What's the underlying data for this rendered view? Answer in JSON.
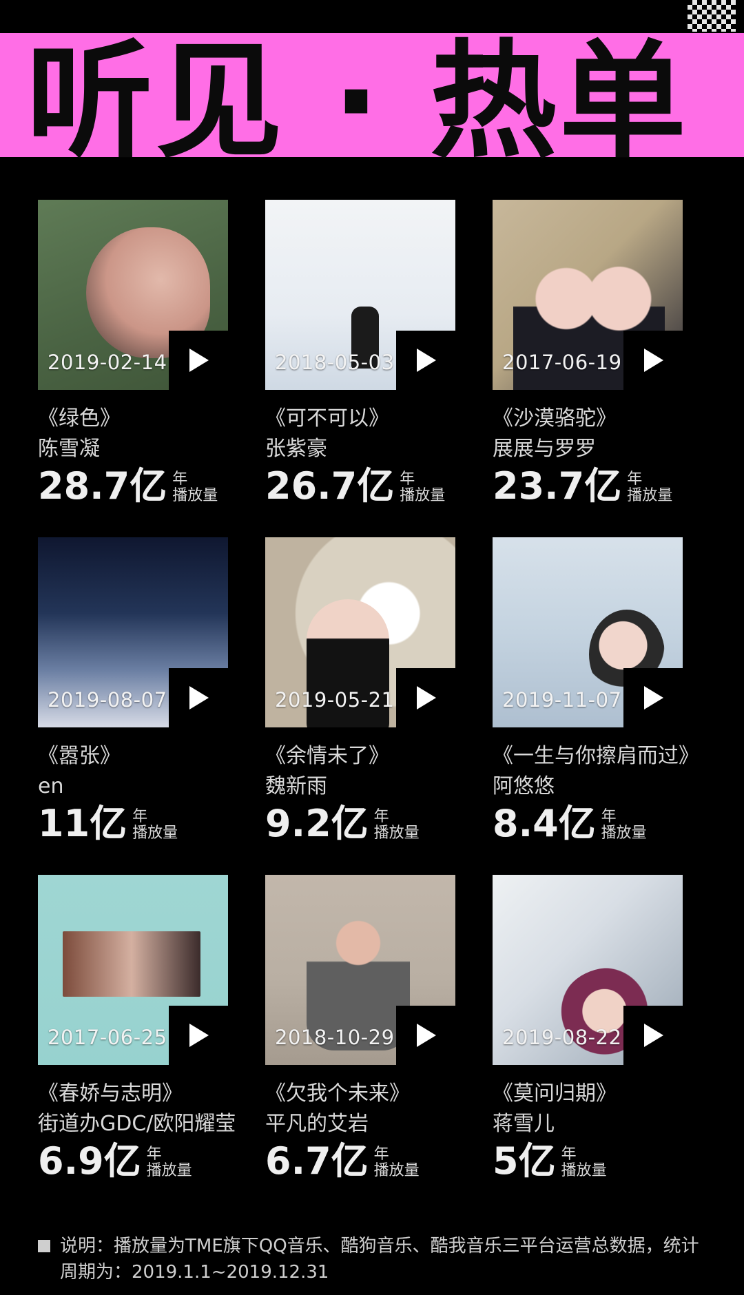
{
  "header": {
    "title": "听见 · 热单"
  },
  "cards": [
    {
      "date": "2019-02-14",
      "title": "《绿色》",
      "artist": "陈雪凝",
      "plays": "28.7亿",
      "unit_top": "年",
      "unit_bottom": "播放量"
    },
    {
      "date": "2018-05-03",
      "title": "《可不可以》",
      "artist": "张紫豪",
      "plays": "26.7亿",
      "unit_top": "年",
      "unit_bottom": "播放量"
    },
    {
      "date": "2017-06-19",
      "title": "《沙漠骆驼》",
      "artist": "展展与罗罗",
      "plays": "23.7亿",
      "unit_top": "年",
      "unit_bottom": "播放量"
    },
    {
      "date": "2019-08-07",
      "title": "《嚣张》",
      "artist": "en",
      "plays": "11亿",
      "unit_top": "年",
      "unit_bottom": "播放量"
    },
    {
      "date": "2019-05-21",
      "title": "《余情未了》",
      "artist": "魏新雨",
      "plays": "9.2亿",
      "unit_top": "年",
      "unit_bottom": "播放量"
    },
    {
      "date": "2019-11-07",
      "title": "《一生与你擦肩而过》",
      "artist": "阿悠悠",
      "plays": "8.4亿",
      "unit_top": "年",
      "unit_bottom": "播放量"
    },
    {
      "date": "2017-06-25",
      "title": "《春娇与志明》",
      "artist": "街道办GDC/欧阳耀莹",
      "plays": "6.9亿",
      "unit_top": "年",
      "unit_bottom": "播放量"
    },
    {
      "date": "2018-10-29",
      "title": "《欠我个未来》",
      "artist": "平凡的艾岩",
      "plays": "6.7亿",
      "unit_top": "年",
      "unit_bottom": "播放量"
    },
    {
      "date": "2019-08-22",
      "title": "《莫问归期》",
      "artist": "蒋雪儿",
      "plays": "5亿",
      "unit_top": "年",
      "unit_bottom": "播放量"
    }
  ],
  "footer": {
    "note": "说明：播放量为TME旗下QQ音乐、酷狗音乐、酷我音乐三平台运营总数据，统计周期为：2019.1.1~2019.12.31"
  },
  "icons": {
    "play": "play-icon"
  }
}
